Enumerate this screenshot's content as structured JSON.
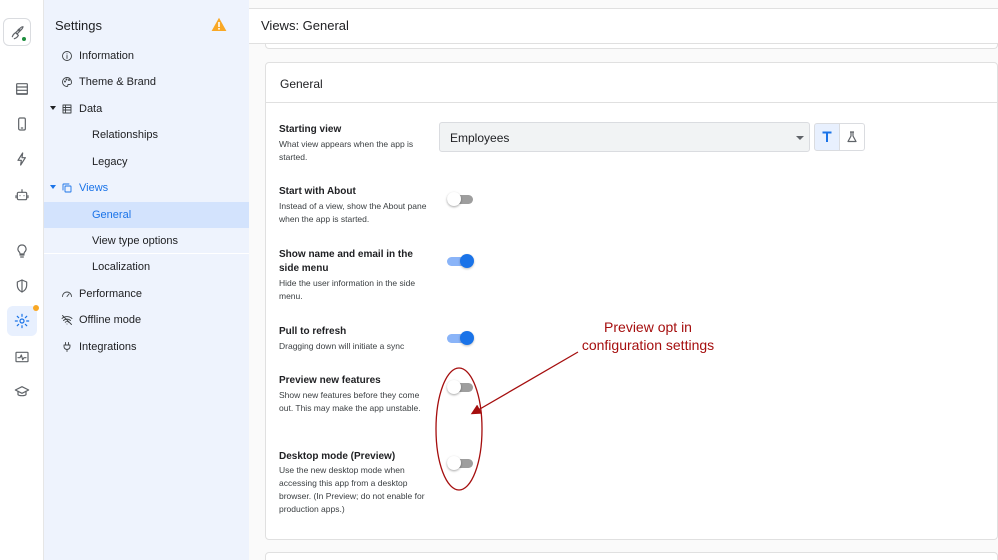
{
  "nav": {
    "title": "Settings",
    "items": [
      {
        "label": "Information"
      },
      {
        "label": "Theme & Brand"
      },
      {
        "label": "Data"
      },
      {
        "label": "Relationships"
      },
      {
        "label": "Legacy"
      },
      {
        "label": "Views"
      },
      {
        "label": "General"
      },
      {
        "label": "View type options"
      },
      {
        "label": "Localization"
      },
      {
        "label": "Performance"
      },
      {
        "label": "Offline mode"
      },
      {
        "label": "Integrations"
      }
    ]
  },
  "header": {
    "title": "Views: General"
  },
  "card": {
    "title": "General"
  },
  "settings": {
    "starting_view": {
      "label": "Starting view",
      "desc": "What view appears when the app is started.",
      "value": "Employees"
    },
    "start_with_about": {
      "label": "Start with About",
      "desc": "Instead of a view, show the About pane when the app is started.",
      "on": false
    },
    "show_name_email": {
      "label": "Show name and email in the side menu",
      "desc": "Hide the user information in the side menu.",
      "on": true
    },
    "pull_to_refresh": {
      "label": "Pull to refresh",
      "desc": "Dragging down will initiate a sync",
      "on": true
    },
    "preview_features": {
      "label": "Preview new features",
      "desc": "Show new features before they come out. This may make the app unstable.",
      "on": false
    },
    "desktop_mode": {
      "label": "Desktop mode (Preview)",
      "desc": "Use the new desktop mode when accessing this app from a desktop browser. (In Preview; do not enable for production apps.)",
      "on": false
    }
  },
  "annotation": {
    "line1": "Preview opt in",
    "line2": "configuration settings"
  },
  "colors": {
    "accent": "#1a73e8",
    "nav_bg": "#eef3fd",
    "nav_selected": "#d3e3fd",
    "annotation": "#a50e0e",
    "warning": "#f9a825"
  }
}
